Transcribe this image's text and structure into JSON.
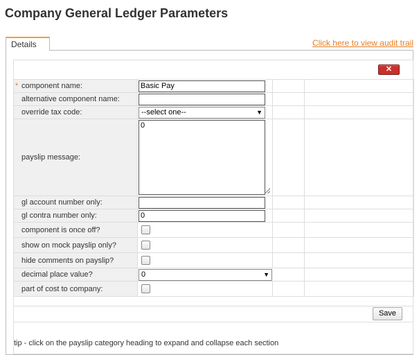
{
  "page": {
    "title": "Company General Ledger Parameters",
    "tab_label": "Details",
    "audit_link": "Click here to view audit trail",
    "close_label": "✕"
  },
  "form": {
    "component_name": {
      "label": "component name:",
      "value": "Basic Pay",
      "required": true
    },
    "alternative_component_name": {
      "label": "alternative component name:",
      "value": ""
    },
    "override_tax_code": {
      "label": "override tax code:",
      "selected": "--select one--"
    },
    "payslip_message": {
      "label": "payslip message:",
      "value": "0"
    },
    "gl_account_number_only": {
      "label": "gl account number only:",
      "value": ""
    },
    "gl_contra_number_only": {
      "label": "gl contra number only:",
      "value": "0"
    },
    "component_is_once_off": {
      "label": "component is once off?",
      "checked": false
    },
    "show_on_mock_payslip_only": {
      "label": "show on mock payslip only?",
      "checked": false
    },
    "hide_comments_on_payslip": {
      "label": "hide comments on payslip?",
      "checked": false
    },
    "decimal_place_value": {
      "label": "decimal place value?",
      "selected": "0"
    },
    "part_of_cost_to_company": {
      "label": "part of cost to company:",
      "checked": false
    }
  },
  "actions": {
    "save_label": "Save"
  },
  "tip": "tip - click on the payslip category heading to expand and collapse each section",
  "colors": {
    "accent": "#e67e22",
    "close_button": "#c9302c",
    "label_bg": "#f0f0f0"
  }
}
